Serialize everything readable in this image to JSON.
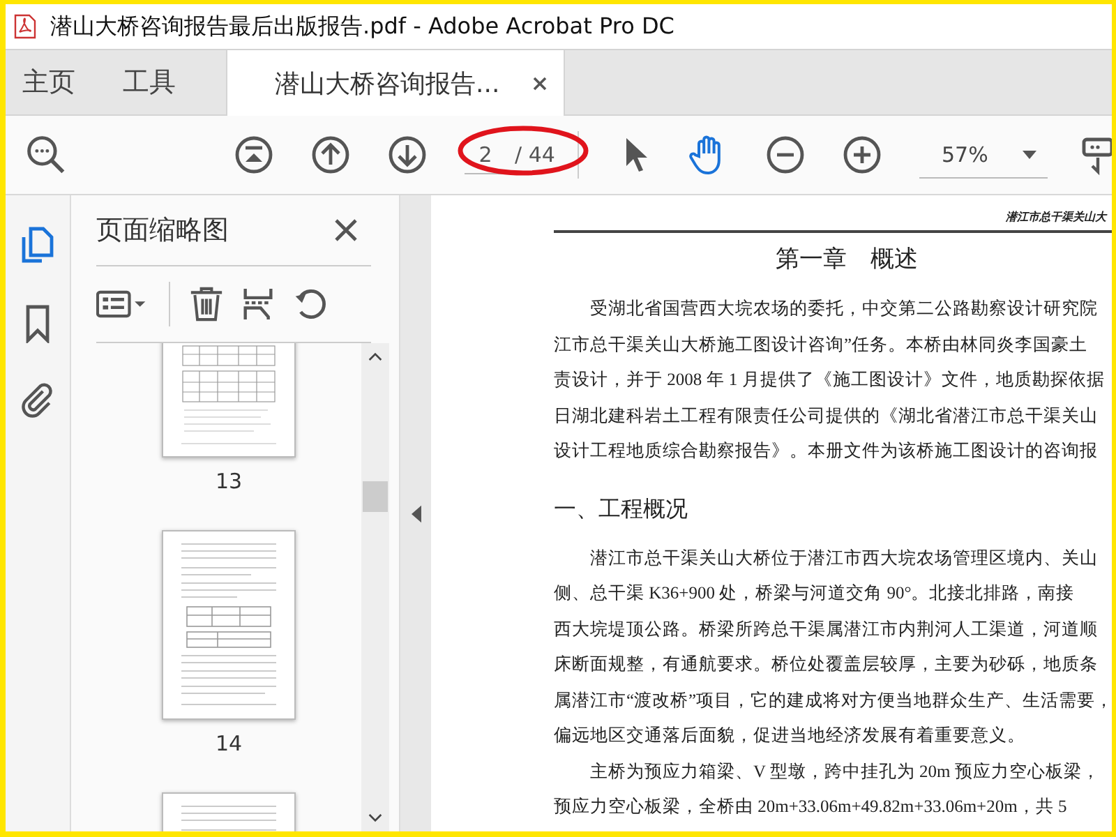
{
  "window": {
    "title": "潜山大桥咨询报告最后出版报告.pdf - Adobe Acrobat Pro DC"
  },
  "tabs": [
    {
      "label": "主页",
      "selected": false
    },
    {
      "label": "工具",
      "selected": false
    },
    {
      "label": "潜山大桥咨询报告...",
      "selected": true
    }
  ],
  "toolbar": {
    "page_value": "2",
    "page_total": "/ 44",
    "zoom": "57%",
    "tools": [
      {
        "kind": "select",
        "selected": false
      },
      {
        "kind": "hand",
        "selected": true
      }
    ],
    "annotations": [
      {
        "kind": "ellipse"
      }
    ]
  },
  "sidebar": {
    "rail": [
      {
        "kind": "pages",
        "selected": true
      },
      {
        "kind": "bookmarks",
        "selected": false
      },
      {
        "kind": "attachments",
        "selected": false
      }
    ],
    "panel": {
      "title": "页面缩略图",
      "thumbnails": [
        {
          "label": "13",
          "kind": "tables"
        },
        {
          "label": "14",
          "kind": "text"
        },
        {
          "kind": "text"
        }
      ]
    }
  },
  "document": {
    "running_header": "潜江市总干渠关山大",
    "chapter_title": "第一章　概述",
    "blocks": [
      {
        "kind": "paragraph",
        "lines": [
          "受湖北省国营西大垸农场的委托，中交第二公路勘察设计研究院",
          "江市总干渠关山大桥施工图设计咨询”任务。本桥由林同炎李国豪土",
          "责设计，并于 2008 年 1 月提供了《施工图设计》文件，地质勘探依据",
          "日湖北建科岩土工程有限责任公司提供的《湖北省潜江市总干渠关山",
          "设计工程地质综合勘察报告》。本册文件为该桥施工图设计的咨询报"
        ]
      },
      {
        "kind": "heading",
        "text": "一、工程概况"
      },
      {
        "kind": "paragraph",
        "lines": [
          "潜江市总干渠关山大桥位于潜江市西大垸农场管理区境内、关山",
          "侧、总干渠 K36+900 处，桥梁与河道交角 90°。北接北排路，南接",
          "西大垸堤顶公路。桥梁所跨总干渠属潜江市内荆河人工渠道，河道顺",
          "床断面规整，有通航要求。桥位处覆盖层较厚，主要为砂砾，地质条",
          "属潜江市“渡改桥”项目，它的建成将对方便当地群众生产、生活需要，",
          "偏远地区交通落后面貌，促进当地经济发展有着重要意义。"
        ]
      },
      {
        "kind": "paragraph",
        "lines": [
          "主桥为预应力箱梁、V 型墩，跨中挂孔为 20m 预应力空心板梁，",
          "预应力空心板梁，全桥由 20m+33.06m+49.82m+33.06m+20m，共 5"
        ]
      }
    ]
  }
}
